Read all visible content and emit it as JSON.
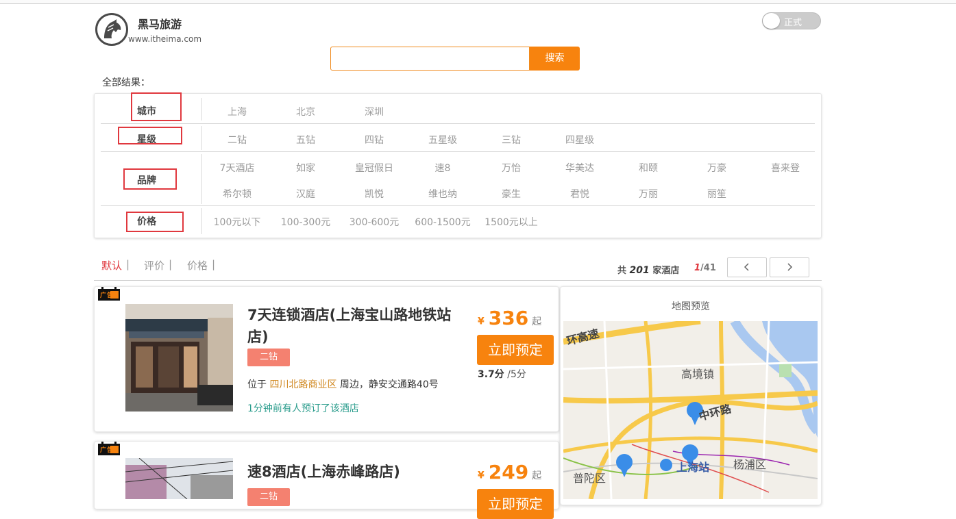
{
  "header": {
    "brand": "黑马旅游",
    "domain": "www.itheima.com",
    "toggle_label": "正式"
  },
  "search": {
    "value": "",
    "placeholder": "",
    "button_label": "搜索"
  },
  "results_label": "全部结果：",
  "filters": {
    "city": {
      "label": "城市",
      "options": [
        "上海",
        "北京",
        "深圳"
      ]
    },
    "star": {
      "label": "星级",
      "options": [
        "二钻",
        "五钻",
        "四钻",
        "五星级",
        "三钻",
        "四星级"
      ]
    },
    "brand": {
      "label": "品牌",
      "options": [
        "7天酒店",
        "如家",
        "皇冠假日",
        "速8",
        "万怡",
        "华美达",
        "和颐",
        "万豪",
        "喜来登",
        "希尔顿",
        "汉庭",
        "凯悦",
        "维也纳",
        "豪生",
        "君悦",
        "万丽",
        "丽笙"
      ]
    },
    "price": {
      "label": "价格",
      "options": [
        "100元以下",
        "100-300元",
        "300-600元",
        "600-1500元",
        "1500元以上"
      ]
    }
  },
  "sort": {
    "default": "默认",
    "rating": "评价",
    "price": "价格",
    "sep": "|"
  },
  "summary": {
    "prefix": "共",
    "count": "201",
    "suffix": "家酒店",
    "current_page": "1",
    "total_pages": "/41"
  },
  "pager": {
    "prev": "‹",
    "next": "›"
  },
  "ad_label": "广告",
  "hotels": [
    {
      "name": "7天连锁酒店(上海宝山路地铁站店)",
      "star": "二钻",
      "address_prefix": "位于",
      "business_zone": "四川北路商业区",
      "address_suffix": "周边，静安交通路40号",
      "recent_booking": "1分钟前有人预订了该酒店",
      "currency": "¥",
      "price": "336",
      "price_suffix": "起",
      "book_label": "立即预定",
      "score": "3.7分",
      "score_max": "/5分"
    },
    {
      "name": "速8酒店(上海赤峰路店)",
      "star": "二钻",
      "currency": "¥",
      "price": "249",
      "price_suffix": "起",
      "book_label": "立即预定"
    }
  ],
  "map": {
    "title": "地图预览",
    "labels": {
      "ring": "环高速",
      "town": "高境镇",
      "middle_ring": "中环路",
      "station": "上海站",
      "district_east": "杨浦区",
      "district_west": "普陀区"
    }
  },
  "colors": {
    "accent": "#f7830e",
    "active_sort": "#e0383e",
    "star_badge": "#f48170",
    "highlight_box": "#e0383e",
    "booking_text": "#2a9c8c",
    "zone_text": "#d18a24"
  }
}
